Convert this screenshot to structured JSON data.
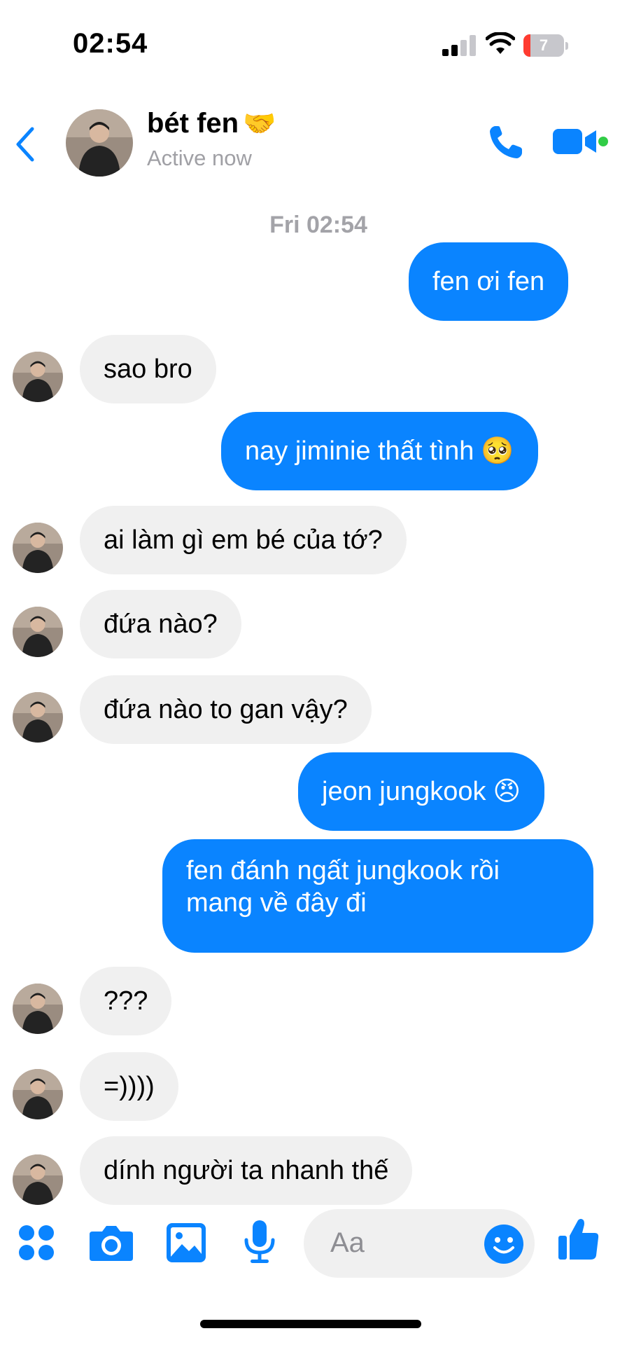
{
  "status_bar": {
    "time": "02:54",
    "battery_level": "7",
    "icons": [
      "cellular-signal-icon",
      "wifi-icon",
      "battery-low-icon"
    ]
  },
  "header": {
    "contact_name": "bét fen",
    "contact_emoji": "🤝",
    "status": "Active now",
    "icons": [
      "back-chevron-icon",
      "phone-icon",
      "video-camera-icon"
    ]
  },
  "conversation": {
    "timestamp": "Fri 02:54",
    "messages": [
      {
        "direction": "out",
        "text": "fen ơi fen"
      },
      {
        "direction": "in",
        "text": "sao bro"
      },
      {
        "direction": "out",
        "text": "nay jiminie thất tình",
        "emoji": "🥺"
      },
      {
        "direction": "in",
        "text": "ai làm gì em bé của tớ?"
      },
      {
        "direction": "in",
        "text": "đứa nào?"
      },
      {
        "direction": "in",
        "text": "đứa nào to gan vậy?"
      },
      {
        "direction": "out",
        "text": "jeon jungkook",
        "emoji": "😠"
      },
      {
        "direction": "out",
        "text": "fen đánh ngất jungkook rồi mang về đây đi"
      },
      {
        "direction": "in",
        "text": "???"
      },
      {
        "direction": "in",
        "text": "=))))"
      },
      {
        "direction": "in",
        "text": "dính người ta nhanh thế"
      }
    ]
  },
  "composer": {
    "placeholder": "Aa",
    "icons": [
      "apps-grid-icon",
      "camera-icon",
      "photo-gallery-icon",
      "microphone-icon",
      "emoji-smiley-icon",
      "thumbs-up-icon"
    ]
  },
  "colors": {
    "accent": "#0a84ff",
    "outgoing_bubble": "#0a84ff",
    "incoming_bubble": "#f0f0f0",
    "active_dot": "#31cc46",
    "battery_low": "#ff3b30"
  }
}
